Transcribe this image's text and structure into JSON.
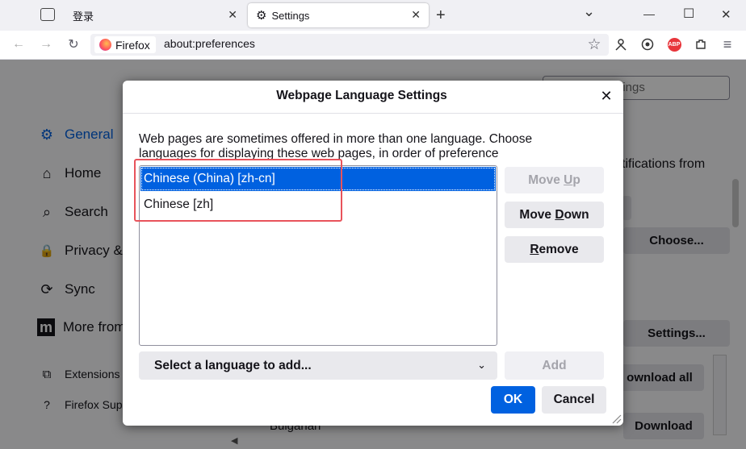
{
  "browser": {
    "tabs": [
      {
        "title": "登录",
        "close": "✕"
      },
      {
        "title": "Settings",
        "close": "✕"
      }
    ],
    "new_tab": "+",
    "window_controls": {
      "chevron": "⌄",
      "minimize": "—",
      "maximize": "☐",
      "close": "✕"
    },
    "identity_label": "Firefox",
    "url": "about:preferences",
    "toolbar_glyphs": {
      "back": "←",
      "forward": "→",
      "reload": "↻",
      "bookmark": "☆",
      "abp": "ABP",
      "menu": "≡"
    }
  },
  "sidebar": {
    "items": [
      {
        "label": "General",
        "glyph": "⚙"
      },
      {
        "label": "Home",
        "glyph": "⌂"
      },
      {
        "label": "Search",
        "glyph": "⌕"
      },
      {
        "label": "Privacy &",
        "glyph": "🔒"
      },
      {
        "label": "Sync",
        "glyph": "⟳"
      },
      {
        "label": "More from",
        "glyph": "m"
      }
    ],
    "footer": [
      {
        "label": "Extensions",
        "glyph": "⧉"
      },
      {
        "label": "Firefox Sup",
        "glyph": "?"
      }
    ]
  },
  "background": {
    "search_placeholder": "ttings",
    "notifications_text": "tifications from",
    "choose_label": "Choose...",
    "settings_label": "Settings...",
    "download_all_label": "ownload all",
    "download_label": "Download",
    "bulgarian": "Bulgarian"
  },
  "dialog": {
    "title": "Webpage Language Settings",
    "close": "✕",
    "description": "Web pages are sometimes offered in more than one language. Choose languages for displaying these web pages, in order of preference",
    "languages": [
      "Chinese (China) [zh-cn]",
      "Chinese [zh]"
    ],
    "selected_index": 0,
    "buttons": {
      "move_up": "Move Up",
      "move_down": "Move Down",
      "remove": "Remove",
      "add": "Add",
      "ok": "OK",
      "cancel": "Cancel"
    },
    "select_placeholder": "Select a language to add...",
    "select_chevron": "⌄"
  },
  "colors": {
    "accent": "#0061e0",
    "highlight_box": "#e8535b"
  }
}
